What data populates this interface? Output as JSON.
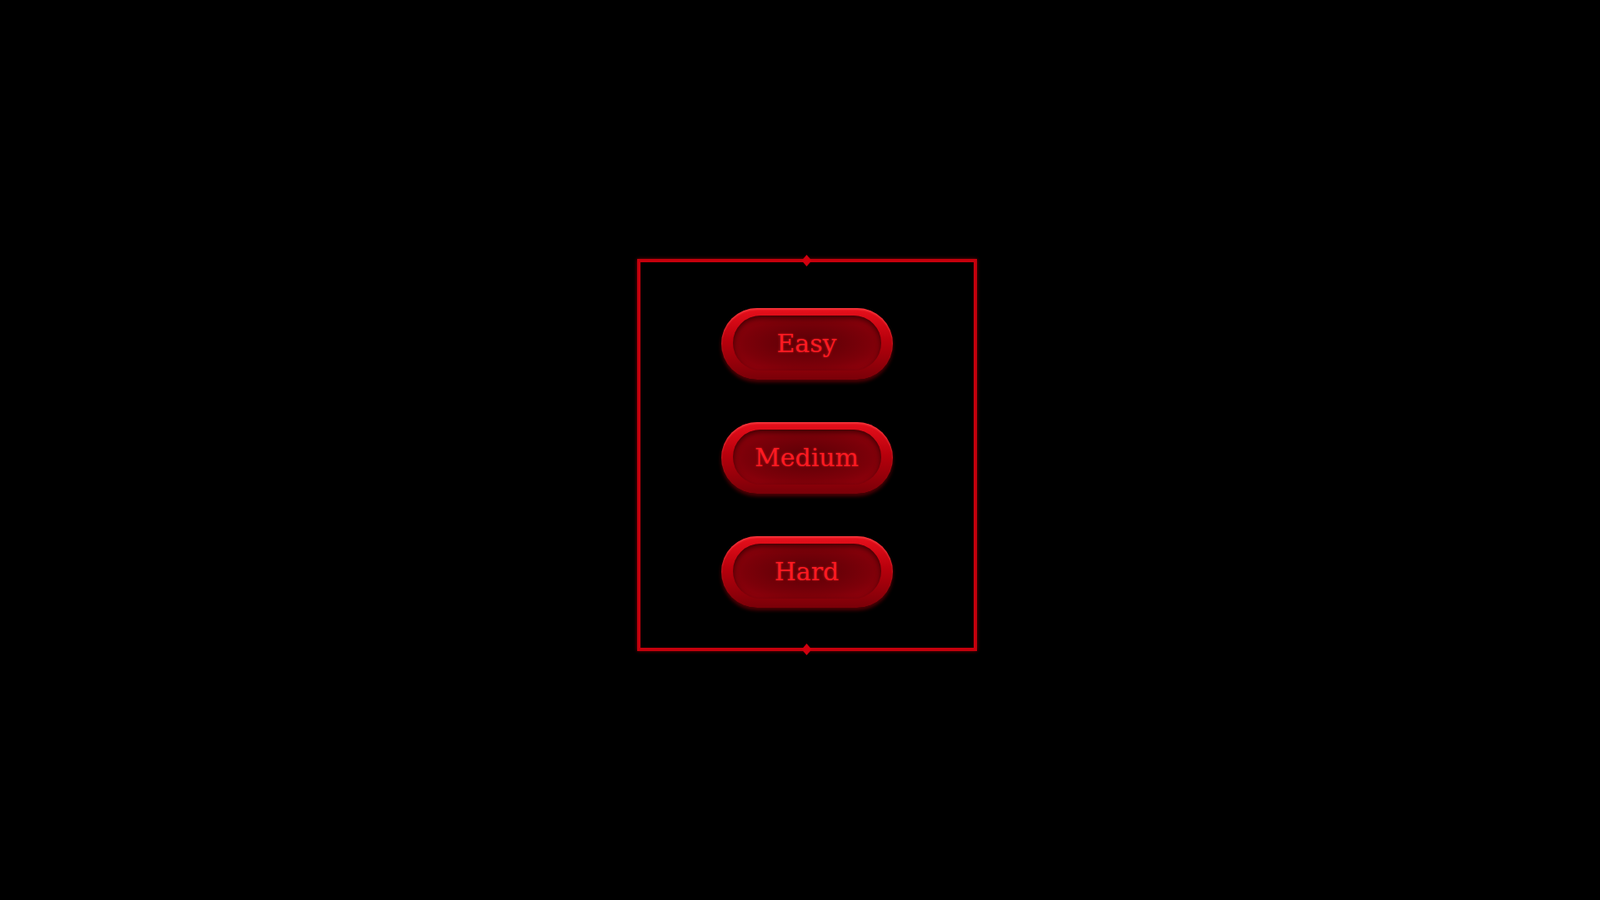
{
  "menu": {
    "buttons": [
      {
        "label": "Easy"
      },
      {
        "label": "Medium"
      },
      {
        "label": "Hard"
      }
    ]
  }
}
